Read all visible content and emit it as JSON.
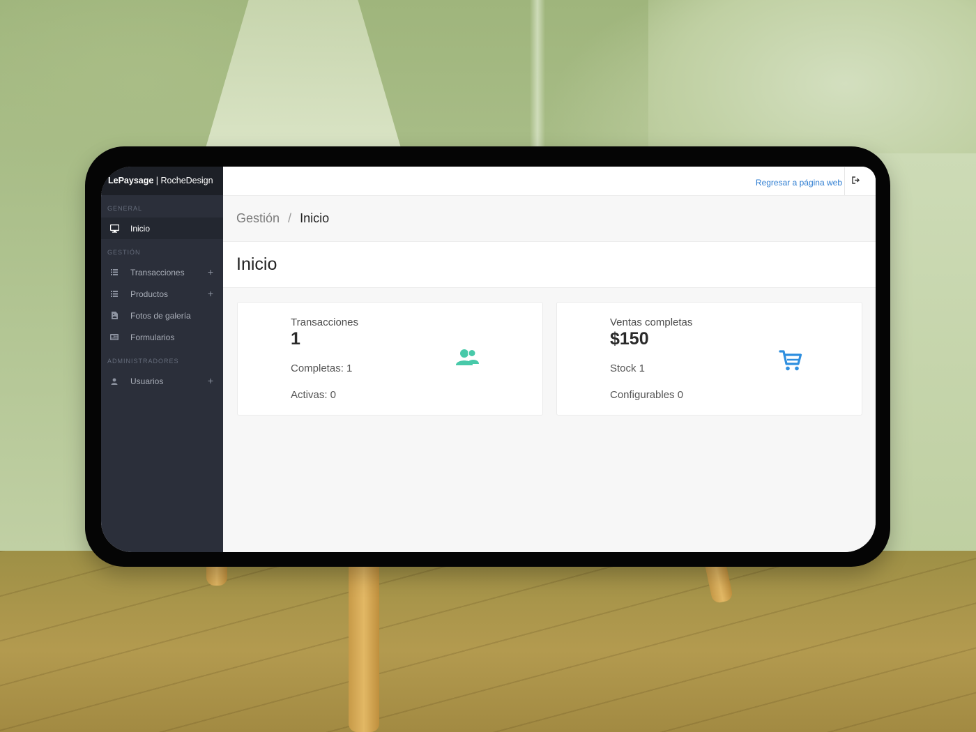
{
  "sidebar": {
    "brand_bold": "LePaysage",
    "brand_rest": " | RocheDesign",
    "sections": [
      {
        "title": "GENERAL",
        "items": [
          {
            "label": "Inicio",
            "icon": "monitor-icon",
            "active": true,
            "expandable": false
          }
        ]
      },
      {
        "title": "GESTIÓN",
        "items": [
          {
            "label": "Transacciones",
            "icon": "list-icon",
            "active": false,
            "expandable": true
          },
          {
            "label": "Productos",
            "icon": "list-icon",
            "active": false,
            "expandable": true
          },
          {
            "label": "Fotos de galería",
            "icon": "file-image-icon",
            "active": false,
            "expandable": false
          },
          {
            "label": "Formularios",
            "icon": "id-card-icon",
            "active": false,
            "expandable": false
          }
        ]
      },
      {
        "title": "ADMINISTRADORES",
        "items": [
          {
            "label": "Usuarios",
            "icon": "user-icon",
            "active": false,
            "expandable": true
          }
        ]
      }
    ],
    "plus_symbol": "+"
  },
  "topbar": {
    "back_link": "Regresar a página web",
    "logout_icon": "logout-icon"
  },
  "breadcrumb": {
    "root": "Gestión",
    "separator": "/",
    "current": "Inicio"
  },
  "page": {
    "title": "Inicio"
  },
  "cards": [
    {
      "label": "Transacciones",
      "value": "1",
      "line1": "Completas: 1",
      "line2": "Activas: 0",
      "icon": "users-icon",
      "icon_color": "#48c9a9"
    },
    {
      "label": "Ventas completas",
      "value": "$150",
      "line1": "Stock 1",
      "line2": "Configurables 0",
      "icon": "shopping-cart-icon",
      "icon_color": "#2f8fdf"
    }
  ],
  "colors": {
    "sidebar_bg": "#2b2f3a",
    "brand_bg": "#1d2027",
    "link": "#2c7cd1"
  }
}
